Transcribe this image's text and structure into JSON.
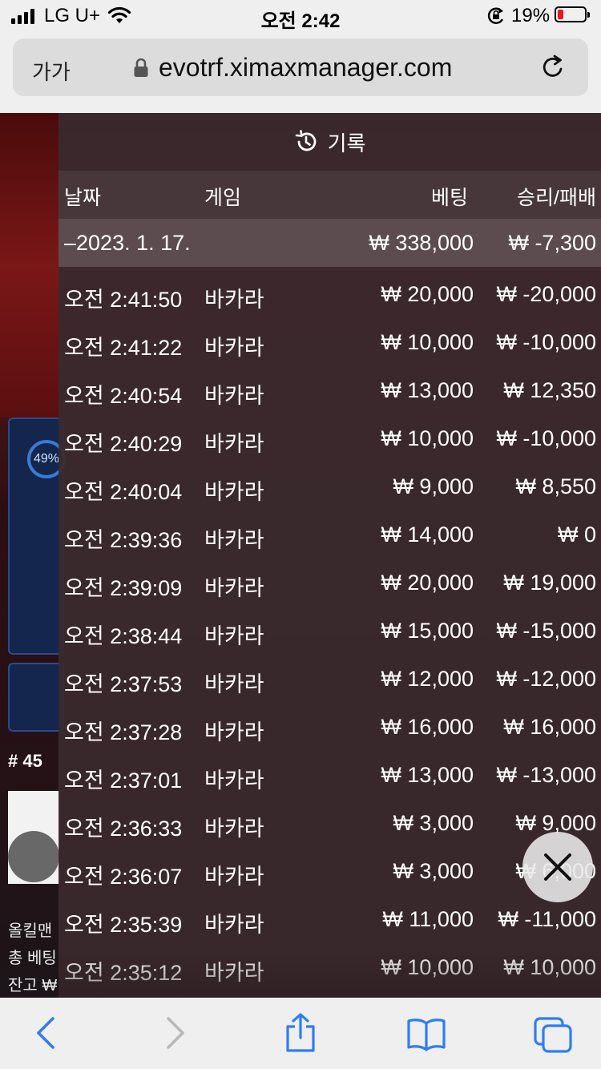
{
  "status_bar": {
    "carrier": "LG U+",
    "time": "오전 2:42",
    "battery_percent": "19%",
    "battery_level": 0.19
  },
  "browser": {
    "text_size_label": "가가",
    "url": "evotrf.ximaxmanager.com"
  },
  "background_game": {
    "progress_label": "49%",
    "round_label": "# 45",
    "lines": [
      "올킬맨",
      "총 베팅",
      "잔고 ₩"
    ]
  },
  "records": {
    "title": "기록",
    "columns": {
      "date": "날짜",
      "game": "게임",
      "bet": "베팅",
      "win_loss": "승리/패배"
    },
    "date_group": {
      "date": "–2023. 1. 17.",
      "total_bet": "₩ 338,000",
      "total_win_loss": "₩ -7,300"
    },
    "rows": [
      {
        "time": "오전 2:41:50",
        "game": "바카라",
        "bet": "₩ 20,000",
        "win_loss": "₩ -20,000"
      },
      {
        "time": "오전 2:41:22",
        "game": "바카라",
        "bet": "₩ 10,000",
        "win_loss": "₩ -10,000"
      },
      {
        "time": "오전 2:40:54",
        "game": "바카라",
        "bet": "₩ 13,000",
        "win_loss": "₩ 12,350"
      },
      {
        "time": "오전 2:40:29",
        "game": "바카라",
        "bet": "₩ 10,000",
        "win_loss": "₩ -10,000"
      },
      {
        "time": "오전 2:40:04",
        "game": "바카라",
        "bet": "₩ 9,000",
        "win_loss": "₩ 8,550"
      },
      {
        "time": "오전 2:39:36",
        "game": "바카라",
        "bet": "₩ 14,000",
        "win_loss": "₩ 0"
      },
      {
        "time": "오전 2:39:09",
        "game": "바카라",
        "bet": "₩ 20,000",
        "win_loss": "₩ 19,000"
      },
      {
        "time": "오전 2:38:44",
        "game": "바카라",
        "bet": "₩ 15,000",
        "win_loss": "₩ -15,000"
      },
      {
        "time": "오전 2:37:53",
        "game": "바카라",
        "bet": "₩ 12,000",
        "win_loss": "₩ -12,000"
      },
      {
        "time": "오전 2:37:28",
        "game": "바카라",
        "bet": "₩ 16,000",
        "win_loss": "₩ 16,000"
      },
      {
        "time": "오전 2:37:01",
        "game": "바카라",
        "bet": "₩ 13,000",
        "win_loss": "₩ -13,000"
      },
      {
        "time": "오전 2:36:33",
        "game": "바카라",
        "bet": "₩ 3,000",
        "win_loss": "₩ 9,000"
      },
      {
        "time": "오전 2:36:07",
        "game": "바카라",
        "bet": "₩ 3,000",
        "win_loss": "₩ 6,000"
      },
      {
        "time": "오전 2:35:39",
        "game": "바카라",
        "bet": "₩ 11,000",
        "win_loss": "₩ -11,000"
      },
      {
        "time": "오전 2:35:12",
        "game": "바카라",
        "bet": "₩ 10,000",
        "win_loss": "₩ 10,000"
      }
    ]
  },
  "icons": {
    "history": "history-icon",
    "close": "close-icon",
    "back": "chevron-left-icon",
    "forward": "chevron-right-icon",
    "share": "share-icon",
    "bookmarks": "book-icon",
    "tabs": "tabs-icon"
  },
  "colors": {
    "ios_blue": "#2f7cf6",
    "battery_low": "#e21d1d",
    "panel_bg": "#3a2a2e"
  }
}
